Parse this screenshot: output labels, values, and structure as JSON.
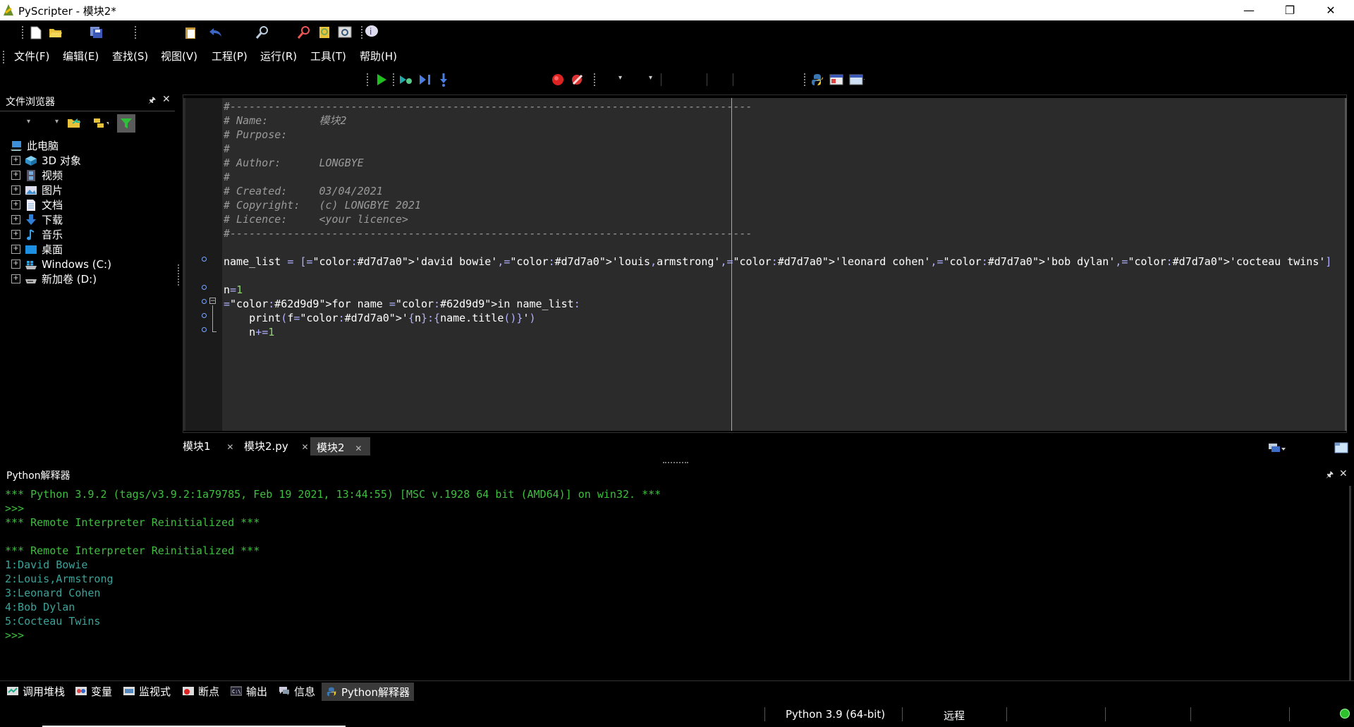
{
  "window": {
    "title": "PyScripter - 模块2*"
  },
  "menu": [
    "文件(F)",
    "编辑(E)",
    "查找(S)",
    "视图(V)",
    "工程(P)",
    "运行(R)",
    "工具(T)",
    "帮助(H)"
  ],
  "file_browser": {
    "title": "文件浏览器",
    "root": "此电脑",
    "items": [
      "3D 对象",
      "视频",
      "图片",
      "文档",
      "下载",
      "音乐",
      "桌面",
      "Windows (C:)",
      "新加卷 (D:)"
    ]
  },
  "editor": {
    "lines": [
      "#----------------------------------------------------------------------------------",
      "# Name:        模块2",
      "# Purpose:",
      "#",
      "# Author:      LONGBYE",
      "#",
      "# Created:     03/04/2021",
      "# Copyright:   (c) LONGBYE 2021",
      "# Licence:     <your licence>",
      "#----------------------------------------------------------------------------------",
      "",
      "name_list = ['david bowie','louis,armstrong','leonard cohen','bob dylan','cocteau twins']",
      "",
      "n=1",
      "for name in name_list:",
      "    print(f'{n}:{name.title()}')",
      "    n+=1"
    ],
    "tabs": [
      "模块1",
      "模块2.py",
      "模块2"
    ]
  },
  "interpreter": {
    "title": "Python解释器",
    "lines": [
      "*** Python 3.9.2 (tags/v3.9.2:1a79785, Feb 19 2021, 13:44:55) [MSC v.1928 64 bit (AMD64)] on win32. ***",
      ">>>",
      "*** Remote Interpreter Reinitialized ***",
      "",
      "*** Remote Interpreter Reinitialized ***",
      "1:David Bowie",
      "2:Louis,Armstrong",
      "3:Leonard Cohen",
      "4:Bob Dylan",
      "5:Cocteau Twins",
      ">>>"
    ]
  },
  "bottom_tabs": [
    "调用堆栈",
    "变量",
    "监视式",
    "断点",
    "输出",
    "信息",
    "Python解释器"
  ],
  "status": {
    "python_version": "Python 3.9 (64-bit)",
    "mode": "远程"
  }
}
